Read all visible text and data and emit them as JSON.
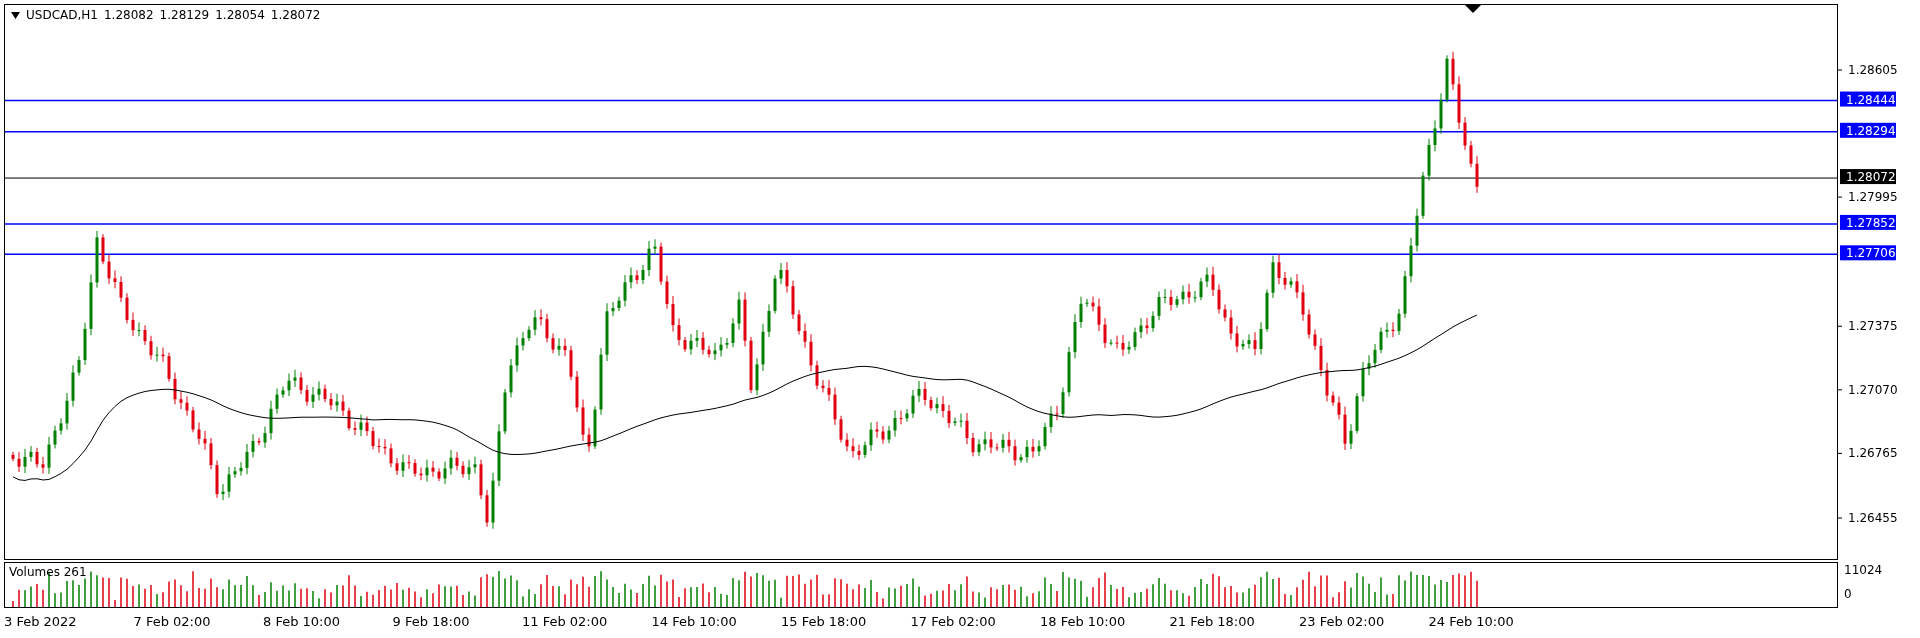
{
  "header": {
    "symbol": "USDCAD,H1",
    "ohlc": [
      "1.28082",
      "1.28129",
      "1.28054",
      "1.28072"
    ]
  },
  "price_axis": {
    "ticks": [
      "1.28605",
      "1.27995",
      "1.27375",
      "1.27070",
      "1.26765",
      "1.26455"
    ]
  },
  "levels": [
    {
      "label": "1.28444",
      "kind": "level"
    },
    {
      "label": "1.28294",
      "kind": "level"
    },
    {
      "label": "1.28072",
      "kind": "current"
    },
    {
      "label": "1.27852",
      "kind": "level"
    },
    {
      "label": "1.27706",
      "kind": "level"
    }
  ],
  "volumes": {
    "label": "Volumes 261",
    "ticks": [
      "11024",
      "0"
    ]
  },
  "time_axis": {
    "labels": [
      "3 Feb 2022",
      "7 Feb 02:00",
      "8 Feb 10:00",
      "9 Feb 18:00",
      "11 Feb 02:00",
      "14 Feb 10:00",
      "15 Feb 18:00",
      "17 Feb 02:00",
      "18 Feb 10:00",
      "21 Feb 18:00",
      "23 Feb 02:00",
      "24 Feb 10:00"
    ]
  }
}
